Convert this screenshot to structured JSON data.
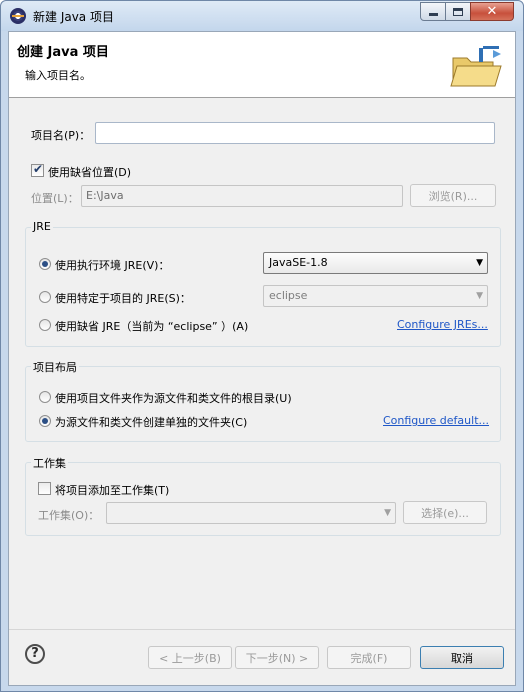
{
  "window": {
    "title": "新建 Java 项目",
    "accent_close": "#c7503c"
  },
  "header": {
    "title": "创建 Java 项目",
    "message": "输入项目名。"
  },
  "project_name": {
    "label": "项目名(P)：",
    "value": ""
  },
  "default_location": {
    "label": "使用缺省位置(D)",
    "checked": true
  },
  "location": {
    "label": "位置(L)：",
    "value": "E:\\Java",
    "browse_label": "浏览(R)..."
  },
  "jre": {
    "group_title": "JRE",
    "option_exec_env_label": "使用执行环境 JRE(V)：",
    "exec_env_value": "JavaSE-1.8",
    "option_project_jre_label": "使用特定于项目的 JRE(S)：",
    "project_jre_value": "eclipse",
    "option_default_jre_label": "使用缺省 JRE（当前为 “eclipse” ）(A)",
    "configure_link": "Configure JREs..."
  },
  "layout": {
    "group_title": "项目布局",
    "option_root_label": "使用项目文件夹作为源文件和类文件的根目录(U)",
    "option_separate_label": "为源文件和类文件创建单独的文件夹(C)",
    "configure_link": "Configure default..."
  },
  "working_set": {
    "group_title": "工作集",
    "add_label": "将项目添加至工作集(T)",
    "field_label": "工作集(O)：",
    "select_label": "选择(e)..."
  },
  "footer": {
    "back_label": "< 上一步(B)",
    "next_label": "下一步(N) >",
    "finish_label": "完成(F)",
    "cancel_label": "取消"
  },
  "icons": {
    "app": "eclipse-icon",
    "help": "help-icon",
    "banner": "new-java-project-folder-icon"
  }
}
